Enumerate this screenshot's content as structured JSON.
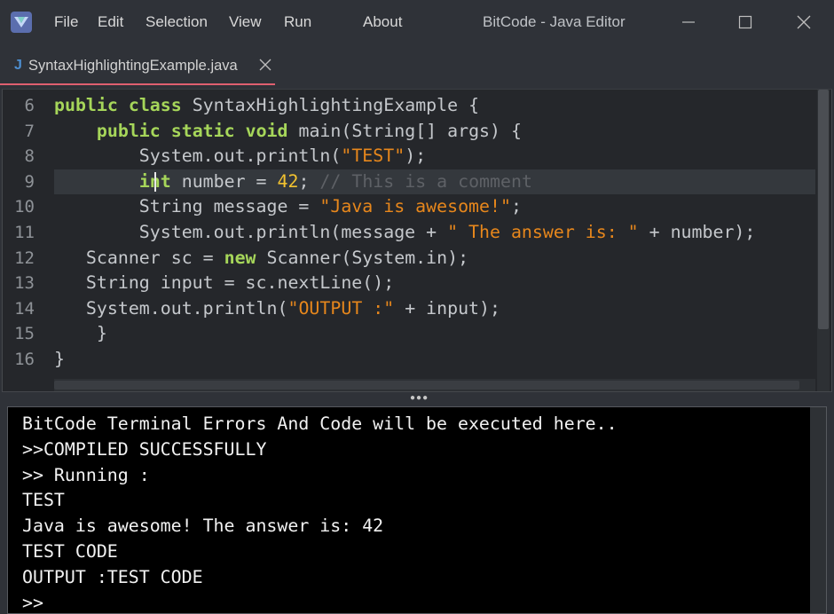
{
  "app": {
    "window_title": "BitCode - Java Editor",
    "menu": [
      "File",
      "Edit",
      "Selection",
      "View",
      "Run",
      "About"
    ]
  },
  "tab": {
    "file_icon": "J",
    "label": "SyntaxHighlightingExample.java",
    "close_icon": "close-icon"
  },
  "editor": {
    "line_numbers": [
      "6",
      "7",
      "8",
      "9",
      "10",
      "11",
      "12",
      "13",
      "14",
      "15",
      "16"
    ],
    "active_line": "9",
    "lines": [
      [
        {
          "t": "public",
          "c": "kw"
        },
        {
          "t": " "
        },
        {
          "t": "class",
          "c": "kw"
        },
        {
          "t": " SyntaxHighlightingExample {"
        }
      ],
      [
        {
          "t": "    "
        },
        {
          "t": "public",
          "c": "kw"
        },
        {
          "t": " "
        },
        {
          "t": "static",
          "c": "kw"
        },
        {
          "t": " "
        },
        {
          "t": "void",
          "c": "kw"
        },
        {
          "t": " main(String[] args) {"
        }
      ],
      [
        {
          "t": "        System.out.println("
        },
        {
          "t": "\"TEST\"",
          "c": "str"
        },
        {
          "t": ");"
        }
      ],
      [
        {
          "t": "        "
        },
        {
          "t": "int",
          "c": "kw"
        },
        {
          "t": " number = "
        },
        {
          "t": "42",
          "c": "num"
        },
        {
          "t": "; "
        },
        {
          "t": "// This is a comment",
          "c": "cmt"
        }
      ],
      [
        {
          "t": "        String message = "
        },
        {
          "t": "\"Java is awesome!\"",
          "c": "str"
        },
        {
          "t": ";"
        }
      ],
      [
        {
          "t": "        System.out.println(message + "
        },
        {
          "t": "\" The answer is: \"",
          "c": "str"
        },
        {
          "t": " + number);"
        }
      ],
      [
        {
          "t": "   Scanner sc = "
        },
        {
          "t": "new",
          "c": "kw"
        },
        {
          "t": " Scanner(System.in);"
        }
      ],
      [
        {
          "t": "   String input = sc.nextLine();"
        }
      ],
      [
        {
          "t": "   System.out.println("
        },
        {
          "t": "\"OUTPUT :\"",
          "c": "str"
        },
        {
          "t": " + input);"
        }
      ],
      [
        {
          "t": "    }"
        }
      ],
      [
        {
          "t": "}"
        }
      ]
    ]
  },
  "terminal": {
    "lines": [
      "BitCode Terminal Errors And Code will be executed here..",
      ">>COMPILED SUCCESSFULLY",
      ">> Running :",
      "TEST",
      "Java is awesome! The answer is: 42",
      "TEST CODE",
      "OUTPUT :TEST CODE",
      ">>"
    ]
  },
  "colors": {
    "keyword": "#a6d65a",
    "string": "#e7871c",
    "number": "#f2c230",
    "comment": "#5e6166",
    "tab_underline": "#e06070",
    "background": "#2f3238",
    "editor_bg": "#25272b",
    "terminal_bg": "#000000"
  }
}
